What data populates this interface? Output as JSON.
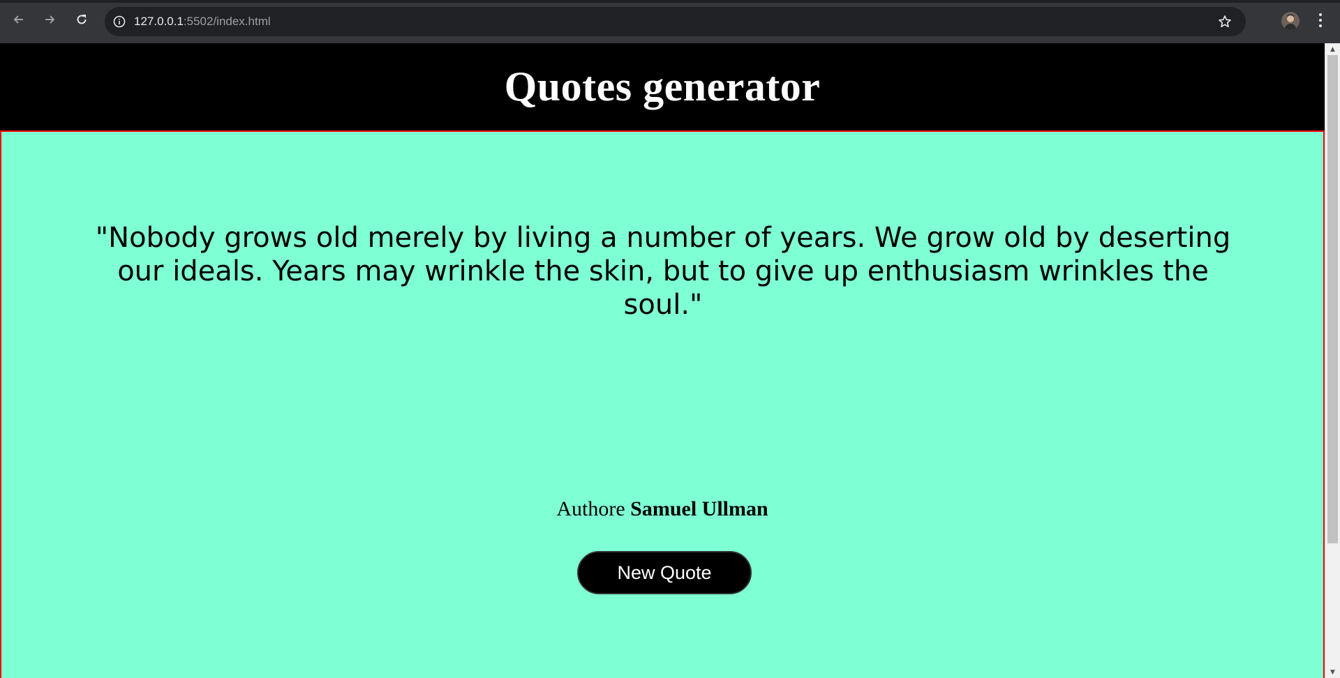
{
  "browser": {
    "url_host": "127.0.0.1",
    "url_rest": ":5502/index.html",
    "back_icon": "arrow-left-icon",
    "forward_icon": "arrow-right-icon",
    "reload_icon": "reload-icon",
    "info_icon": "info-icon",
    "bookmark_icon": "star-icon",
    "menu_icon": "kebab-menu-icon"
  },
  "page": {
    "title": "Quotes generator",
    "quote": "\"Nobody grows old merely by living a number of years. We grow old by deserting our ideals. Years may wrinkle the skin, but to give up enthusiasm wrinkles the soul.\"",
    "author_prefix": "Authore",
    "author_name": "Samuel Ullman",
    "button_label": "New Quote"
  },
  "colors": {
    "header_bg": "#000000",
    "panel_bg": "#7fffd4",
    "panel_border": "#ff0000",
    "button_bg": "#000000"
  }
}
